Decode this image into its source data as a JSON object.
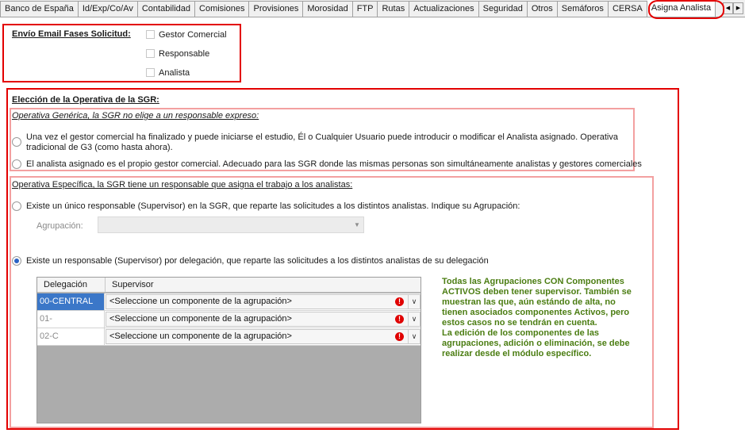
{
  "tabs": [
    "Banco de España",
    "Id/Exp/Co/Av",
    "Contabilidad",
    "Comisiones",
    "Provisiones",
    "Morosidad",
    "FTP",
    "Rutas",
    "Actualizaciones",
    "Seguridad",
    "Otros",
    "Semáforos",
    "CERSA",
    "Asigna Analista"
  ],
  "active_tab": "Asigna Analista",
  "email": {
    "title": "Envío Email Fases Solicitud:",
    "options": [
      "Gestor Comercial",
      "Responsable",
      "Analista"
    ]
  },
  "operativa": {
    "title": "Elección de la Operativa de la SGR:",
    "generica": {
      "title": "Operativa Genérica, la SGR no elige a un responsable expreso:",
      "option1_line1": "Una vez el gestor comercial ha finalizado y puede iniciarse el estudio, Él o Cualquier Usuario puede introducir o modificar el Analista asignado. Operativa",
      "option1_line2": "tradicional de G3 (como hasta ahora).",
      "option2": "El analista asignado es el propio gestor comercial. Adecuado para las SGR donde las mismas personas son simultáneamente analistas y gestores comerciales"
    },
    "especifica": {
      "title": "Operativa Específica, la SGR tiene un responsable que asigna el trabajo a los analistas:",
      "option1": "Existe un único responsable (Supervisor) en la SGR, que reparte las solicitudes a los distintos analistas. Indique su Agrupación:",
      "agrupacion_label": "Agrupación:",
      "option2": "Existe un responsable (Supervisor) por delegación, que reparte las solicitudes a los distintos analistas de su delegación"
    }
  },
  "grid": {
    "headers": [
      "Delegación",
      "Supervisor"
    ],
    "rows": [
      {
        "delegacion": "00-CENTRAL",
        "supervisor": "<Seleccione un componente de la agrupación>"
      },
      {
        "delegacion": "01-",
        "supervisor": "<Seleccione un componente de la agrupación>"
      },
      {
        "delegacion": "02-C",
        "supervisor": "<Seleccione un componente de la agrupación>"
      }
    ]
  },
  "note": {
    "line1": "Todas las Agrupaciones CON Componentes",
    "line2": "ACTIVOS deben tener supervisor. También se",
    "line3": "muestran las que, aún estándo de alta, no",
    "line4": "tienen asociados componentes Activos, pero",
    "line5": "estos casos no se tendrán en cuenta.",
    "line6": "La edición de los componentes de las",
    "line7": "agrupaciones, adición o eliminación, se debe",
    "line8": "realizar desde el módulo específico."
  },
  "colors": {
    "highlight": "#e30000",
    "note_text": "#4b7d12",
    "selection": "#3b77c8"
  },
  "icons": [
    "chevron-left-icon",
    "chevron-right-icon",
    "warning-icon",
    "chevron-down-icon"
  ]
}
